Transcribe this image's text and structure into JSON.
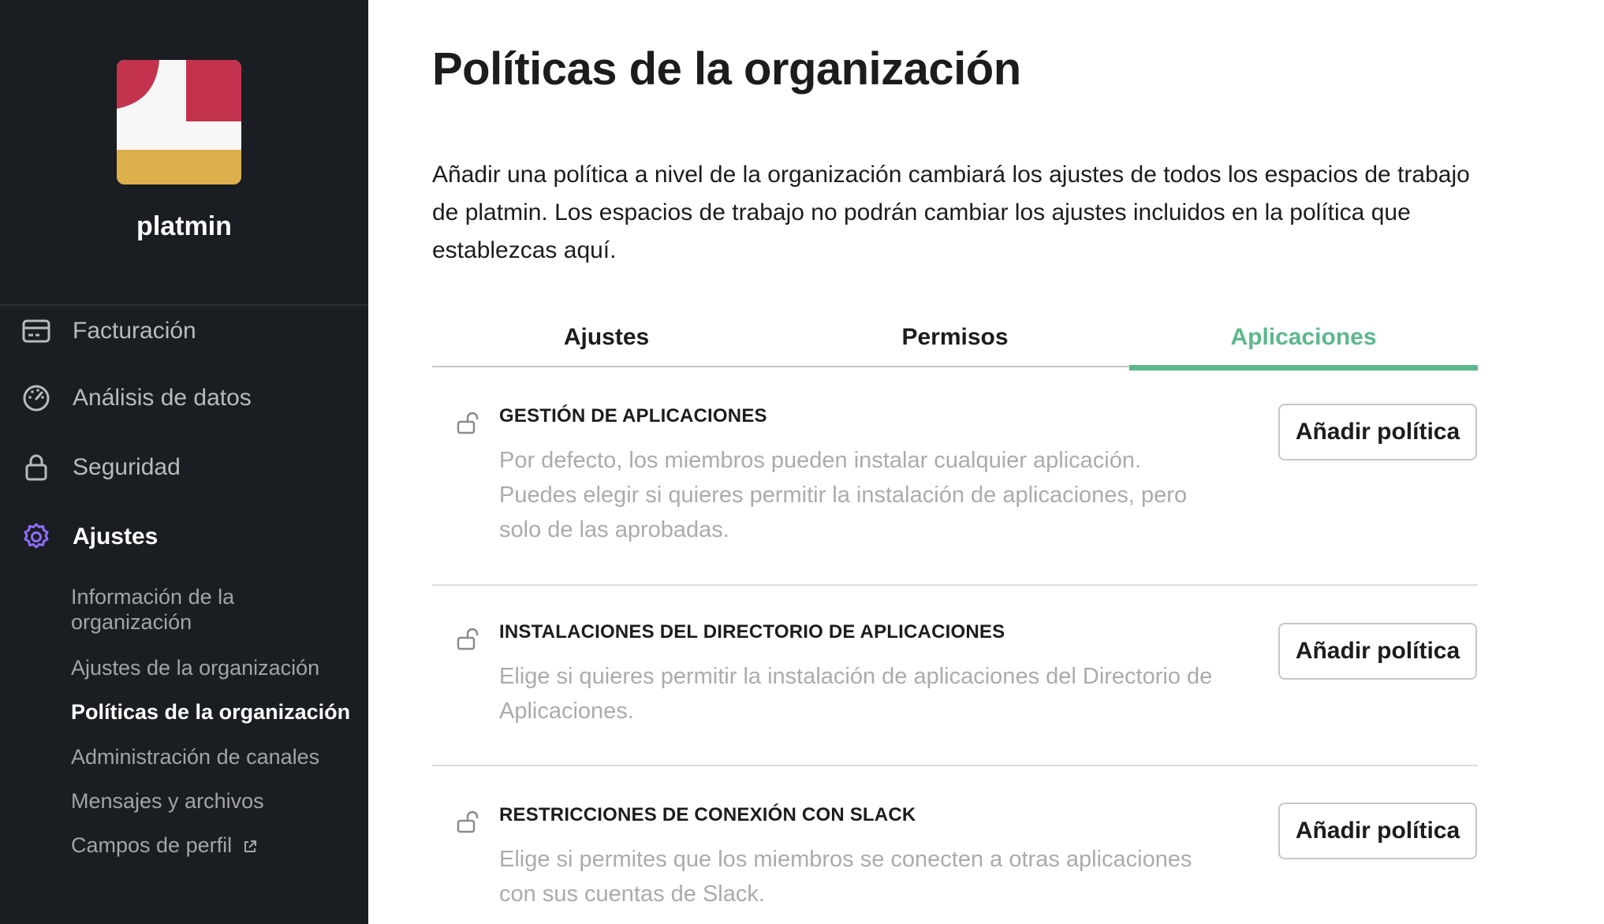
{
  "sidebar": {
    "org_name": "platmin",
    "nav": [
      {
        "label": "Facturación",
        "icon": "credit-card-icon"
      },
      {
        "label": "Análisis de datos",
        "icon": "dashboard-gauge-icon"
      },
      {
        "label": "Seguridad",
        "icon": "lock-icon"
      },
      {
        "label": "Ajustes",
        "icon": "gear-icon"
      }
    ],
    "sub_items": [
      "Información de la organización",
      "Ajustes de la organización",
      "Políticas de la organización",
      "Administración de canales",
      "Mensajes y archivos",
      "Campos de perfil"
    ],
    "colors": {
      "background": "#1a1d21",
      "active_icon": "#8f6cff",
      "logo_red": "#c4334e",
      "logo_gold": "#dcb04a"
    }
  },
  "main": {
    "title": "Políticas de la organización",
    "description": "Añadir una política a nivel de la organización cambiará los ajustes de todos los espacios de trabajo de platmin. Los espacios de trabajo no podrán cambiar los ajustes incluidos en la política que establezcas aquí.",
    "tabs": [
      {
        "label": "Ajustes"
      },
      {
        "label": "Permisos"
      },
      {
        "label": "Aplicaciones"
      }
    ],
    "active_tab": "Aplicaciones",
    "accent_color": "#5cb88b",
    "policies": [
      {
        "title": "GESTIÓN DE APLICACIONES",
        "description": "Por defecto, los miembros pueden instalar cualquier aplicación. Puedes elegir si quieres permitir la instalación de aplicaciones, pero solo de las aprobadas.",
        "button": "Añadir política"
      },
      {
        "title": "INSTALACIONES DEL DIRECTORIO DE APLICACIONES",
        "description": "Elige si quieres permitir la instalación de aplicaciones del Directorio de Aplicaciones.",
        "button": "Añadir política"
      },
      {
        "title": "RESTRICCIONES DE CONEXIÓN CON SLACK",
        "description": "Elige si permites que los miembros se conecten a otras aplicaciones con sus cuentas de Slack.",
        "button": "Añadir política"
      }
    ]
  }
}
